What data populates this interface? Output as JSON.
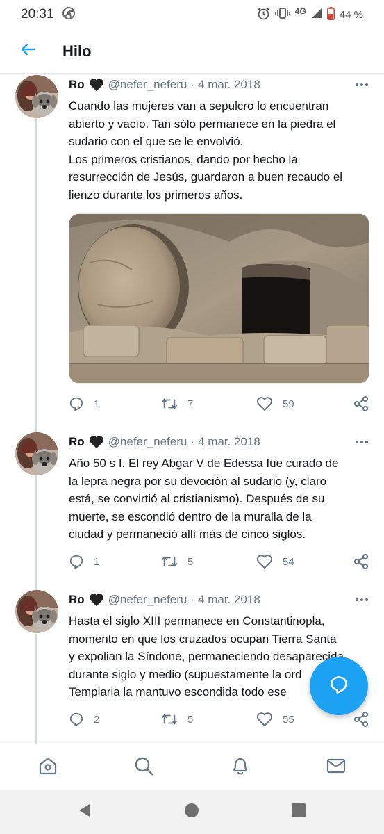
{
  "status_bar": {
    "time": "20:31",
    "network": "4G",
    "battery": "44 %",
    "icons": [
      "chrome-icon",
      "alarm-icon",
      "vibrate-icon",
      "signal-icon",
      "battery-icon"
    ]
  },
  "header": {
    "title": "Hilo",
    "back_icon": "arrow-left-icon"
  },
  "tweets": [
    {
      "name": "Ro",
      "handle": "@nefer_neferu",
      "separator": "·",
      "date": "4 mar. 2018",
      "text": "Cuando las mujeres van a sepulcro lo encuentran\nabierto y vacío. Tan sólo permanece en la piedra el\nsudario con el que se le envolvió.\nLos primeros cristianos, dando por hecho la\nresurrección de Jesús, guardaron a buen recaudo el\nlienzo durante los primeros años.",
      "has_media": true,
      "replies": "1",
      "retweets": "7",
      "likes": "59"
    },
    {
      "name": "Ro",
      "handle": "@nefer_neferu",
      "separator": "·",
      "date": "4 mar. 2018",
      "text": "Año 50 s I. El rey Abgar V de Edessa fue curado de\nla lepra negra por su devoción al sudario (y, claro\nestá, se convirtió al cristianismo). Después de su\nmuerte, se escondió dentro de la muralla de la\nciudad y permaneció allí más de cinco siglos.",
      "has_media": false,
      "replies": "1",
      "retweets": "5",
      "likes": "54"
    },
    {
      "name": "Ro",
      "handle": "@nefer_neferu",
      "separator": "·",
      "date": "4 mar. 2018",
      "text": "Hasta el siglo XIII permanece en Constantinopla,\nmomento en que los cruzados ocupan Tierra Santa\ny expolian la Síndone, permaneciendo desaparecida\ndurante siglo y medio (supuestamente la ord\nTemplaria la mantuvo escondida todo ese",
      "has_media": false,
      "replies": "2",
      "retweets": "5",
      "likes": "55"
    }
  ],
  "colors": {
    "accent": "#1da1f2",
    "text": "#14171a",
    "secondary": "#657786",
    "thread_line": "#cfd9de"
  },
  "bottom_nav": [
    "home-icon",
    "search-icon",
    "notifications-icon",
    "messages-icon"
  ],
  "system_nav": [
    "back-triangle-icon",
    "home-circle-icon",
    "recents-square-icon"
  ]
}
